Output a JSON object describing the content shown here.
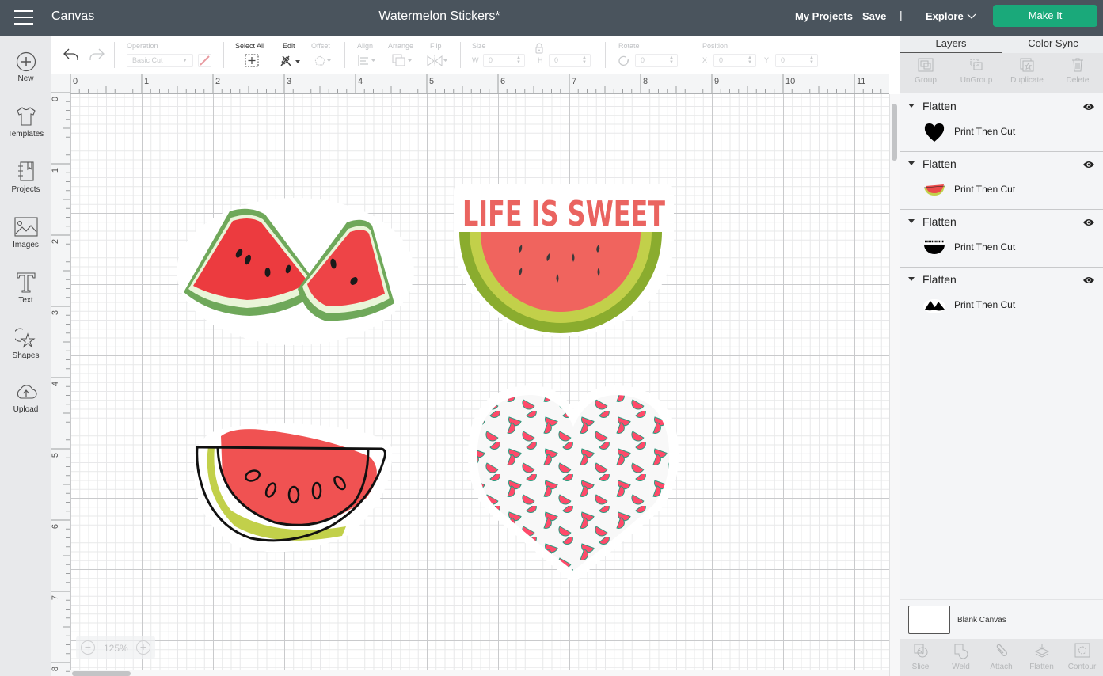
{
  "header": {
    "app_title": "Canvas",
    "document_title": "Watermelon Stickers*",
    "my_projects": "My Projects",
    "save": "Save",
    "separator": "|",
    "explore": "Explore",
    "make_it": "Make It",
    "colors": {
      "bar": "#4a545d",
      "make_it": "#1aa97a"
    }
  },
  "left_sidebar": {
    "items": [
      {
        "label": "New",
        "icon": "plus-circle-icon"
      },
      {
        "label": "Templates",
        "icon": "tshirt-icon"
      },
      {
        "label": "Projects",
        "icon": "notebook-icon"
      },
      {
        "label": "Images",
        "icon": "image-icon"
      },
      {
        "label": "Text",
        "icon": "text-t-icon"
      },
      {
        "label": "Shapes",
        "icon": "shapes-icon"
      },
      {
        "label": "Upload",
        "icon": "cloud-upload-icon"
      }
    ]
  },
  "toolbar": {
    "undo": "undo-icon",
    "redo": "redo-icon",
    "operation": {
      "label": "Operation",
      "value": "Basic Cut"
    },
    "select_all": "Select All",
    "edit": "Edit",
    "offset": "Offset",
    "align": "Align",
    "arrange": "Arrange",
    "flip": "Flip",
    "size": {
      "label": "Size",
      "w_label": "W",
      "w_value": "0",
      "h_label": "H",
      "h_value": "0"
    },
    "rotate": {
      "label": "Rotate",
      "value": "0"
    },
    "position": {
      "label": "Position",
      "x_label": "X",
      "x_value": "0",
      "y_label": "Y",
      "y_value": "0"
    }
  },
  "rulers": {
    "horizontal": [
      "0",
      "1",
      "2",
      "3",
      "4",
      "5",
      "6",
      "7",
      "8",
      "9",
      "10",
      "11"
    ],
    "vertical": [
      "0",
      "1",
      "2",
      "3",
      "4",
      "5",
      "6",
      "7",
      "8"
    ]
  },
  "canvas": {
    "zoom_level": "125%",
    "stickers": [
      {
        "name": "watermelon-slices-photo"
      },
      {
        "name": "life-is-sweet",
        "text": "LIFE IS SWEET"
      },
      {
        "name": "watermelon-outline-drawing"
      },
      {
        "name": "watermelon-pattern-heart"
      }
    ],
    "colors": {
      "watermelon_red": "#f0645e",
      "rind_dark": "#8aac2e",
      "rind_light": "#c2d04a",
      "seed": "#3a3a3a"
    }
  },
  "right_panel": {
    "tabs": [
      {
        "label": "Layers",
        "active": true
      },
      {
        "label": "Color Sync",
        "active": false
      }
    ],
    "actions": [
      "Group",
      "UnGroup",
      "Duplicate",
      "Delete"
    ],
    "layers": [
      {
        "group": "Flatten",
        "name": "Print Then Cut",
        "thumb": "heart"
      },
      {
        "group": "Flatten",
        "name": "Print Then Cut",
        "thumb": "watermelon"
      },
      {
        "group": "Flatten",
        "name": "Print Then Cut",
        "thumb": "life-is-sweet"
      },
      {
        "group": "Flatten",
        "name": "Print Then Cut",
        "thumb": "slices"
      }
    ],
    "blank_canvas": "Blank Canvas",
    "bottom_actions": [
      "Slice",
      "Weld",
      "Attach",
      "Flatten",
      "Contour"
    ]
  }
}
